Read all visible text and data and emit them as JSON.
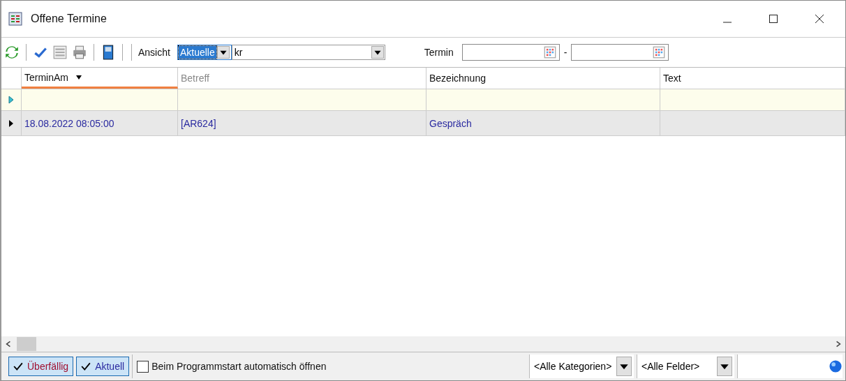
{
  "window": {
    "title": "Offene Termine"
  },
  "toolbar": {
    "view_label": "Ansicht",
    "view_value": "Aktuelle",
    "filter_value": "kr",
    "date_label": "Termin",
    "date_separator": "-"
  },
  "table": {
    "columns": [
      {
        "label": "TerminAm",
        "sorted": true,
        "dimmed": false
      },
      {
        "label": "Betreff",
        "sorted": false,
        "dimmed": true
      },
      {
        "label": "Bezeichnung",
        "sorted": false,
        "dimmed": false
      },
      {
        "label": "Text",
        "sorted": false,
        "dimmed": false
      }
    ],
    "rows": [
      {
        "kind": "new",
        "selected": false,
        "cells": []
      },
      {
        "kind": "data",
        "selected": true,
        "cells": [
          "18.08.2022 08:05:00",
          "[AR624]",
          "Gespräch"
        ]
      }
    ]
  },
  "status_bar": {
    "toggles": [
      {
        "label": "Überfällig",
        "checked": true,
        "color": "#a01030"
      },
      {
        "label": "Aktuell",
        "checked": true,
        "color": "#2a2aa0"
      }
    ],
    "autostart": {
      "label": "Beim Programmstart automatisch öffnen",
      "checked": false
    },
    "category": "<Alle Kategorien>",
    "fields": "<Alle Felder>"
  }
}
